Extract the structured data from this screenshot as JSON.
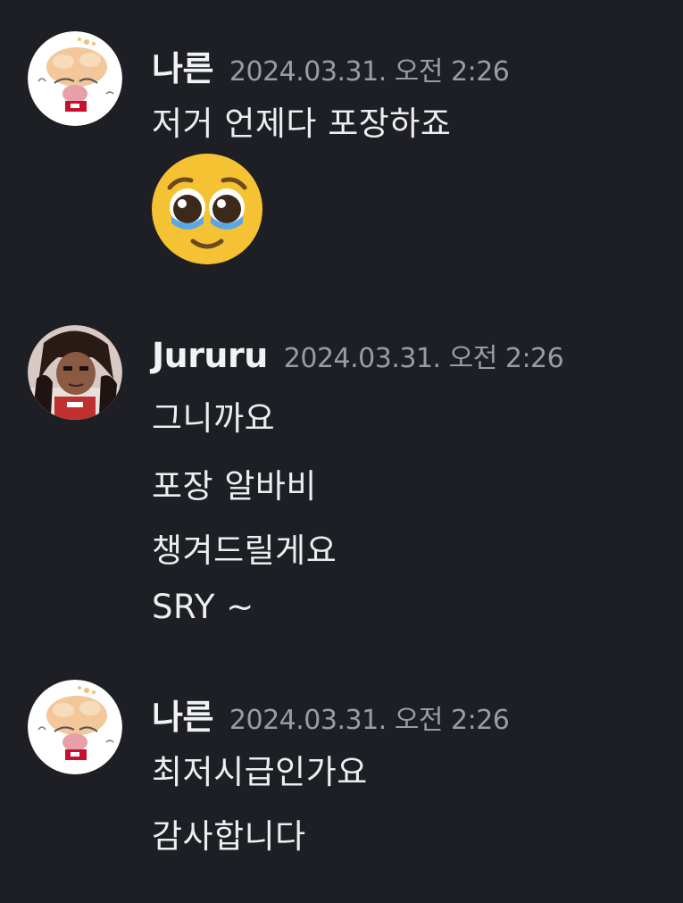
{
  "colors": {
    "background": "#1e1f24",
    "author": "#f2f3f5",
    "timestamp": "#9a9ca3",
    "message_text": "#eceef1"
  },
  "messages": [
    {
      "author": "나른",
      "timestamp": "2024.03.31. 오전 2:26",
      "avatar_icon": "sketch-character-avatar",
      "lines": [
        "저거 언제다 포장하죠"
      ],
      "emoji": "pleading-face-emoji"
    },
    {
      "author": "Jururu",
      "timestamp": "2024.03.31. 오전 2:26",
      "avatar_icon": "dark-haired-character-avatar",
      "lines": [
        "그니까요",
        "포장 알바비",
        "챙겨드릴게요",
        "SRY ~"
      ]
    },
    {
      "author": "나른",
      "timestamp": "2024.03.31. 오전 2:26",
      "avatar_icon": "sketch-character-avatar",
      "lines": [
        "최저시급인가요",
        "감사합니다"
      ]
    }
  ]
}
